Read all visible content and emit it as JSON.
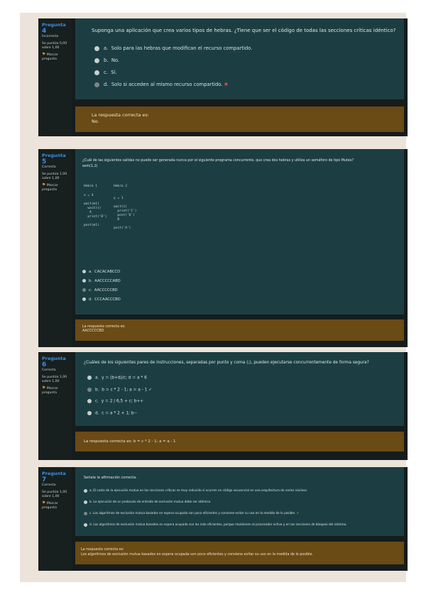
{
  "questions": [
    {
      "number_label": "Pregunta",
      "number": "4",
      "status": "Incorrecta",
      "score": "Se puntúa 0,00",
      "score_max": "sobre 1,00",
      "flag": "Marcar pregunta",
      "text": "Suponga una aplicación que crea varios tipos de hebras. ¿Tiene que ser el código de todas las secciones críticas idéntico?",
      "options": [
        {
          "letter": "a.",
          "text": "Solo para las hebras que modifican el recurso compartido."
        },
        {
          "letter": "b.",
          "text": "No."
        },
        {
          "letter": "c.",
          "text": "Sí."
        },
        {
          "letter": "d.",
          "text": "Solo si acceden al mismo recurso compartido."
        }
      ],
      "feedback_label": "La respuesta correcta es:",
      "feedback_answer": "No."
    },
    {
      "number_label": "Pregunta",
      "number": "5",
      "status": "Correcta",
      "score": "Se puntúa 1,00",
      "score_max": "sobre 1,00",
      "flag": "Marcar pregunta",
      "text": "¿Cuál de las siguientes salidas no puede ser generada nunca por el siguiente programa concurrente, que crea dos hebras y utiliza un semáforo de tipo Mutex?",
      "subtext": "sem(1,2)",
      "hebra1_title": "Hebra 1",
      "hebra2_title": "Hebra 2",
      "hebra1_code": "x = 4\n\nwait(m1)\n  wait(s)\n   A\n  print('B')\n\npost(m1)",
      "hebra2_code": "y = 1\n\nwait(s)\n  print('C')\n  post('D')\n  B\n\npost('A')",
      "options": [
        {
          "letter": "a.",
          "text": "CACACABCCD"
        },
        {
          "letter": "b.",
          "text": "AACCCCCABD"
        },
        {
          "letter": "c.",
          "text": "AACCCCCBD"
        },
        {
          "letter": "d.",
          "text": "CCCAACCCBD"
        }
      ],
      "feedback_label": "La respuesta correcta es:",
      "feedback_answer": "AACCCCCBD"
    },
    {
      "number_label": "Pregunta",
      "number": "6",
      "status": "Correcta",
      "score": "Se puntúa 1,00",
      "score_max": "sobre 1,00",
      "flag": "Marcar pregunta",
      "text": "¿Cuáles de los siguientes pares de instrucciones, separadas por punto y coma (;), pueden ejecutarse concurrentemente de forma segura?",
      "options": [
        {
          "letter": "a.",
          "text": "y = (b+d)/c; d = a * 6"
        },
        {
          "letter": "b.",
          "text": "b = c * 2 - 1; a = a - 1"
        },
        {
          "letter": "c.",
          "text": "y = 2 / 6,5 + c; b++"
        },
        {
          "letter": "d.",
          "text": "c = a * 2 + 1; b--"
        }
      ],
      "feedback_text": "La respuesta correcta es: b = c * 2 - 1; a = a - 1"
    },
    {
      "number_label": "Pregunta",
      "number": "7",
      "status": "Correcta",
      "score": "Se puntúa 1,00",
      "score_max": "sobre 1,00",
      "flag": "Marcar pregunta",
      "text": "Señale la afirmación correcta.",
      "options": [
        {
          "letter": "a.",
          "text": "El costo de la ejecución mutua en las secciones críticas es muy reducido si ocurren en código secuencial en una arquitectura de varios núcleos."
        },
        {
          "letter": "b.",
          "text": "La ejecución de un protocolo de entrada de exclusión mutua debe ser atómico."
        },
        {
          "letter": "c.",
          "text": "Los algoritmos de exclusión mutua basados en espera ocupada son poco eficientes y conviene evitar su uso en la medida de lo posible."
        },
        {
          "letter": "d.",
          "text": "Los algoritmos de exclusión mutua basados en espera ocupada son los más eficientes, porque mantienen al procesador activo y en las secciones de bloqueo del sistema."
        }
      ],
      "feedback_label": "La respuesta correcta es:",
      "feedback_answer": "Los algoritmos de exclusión mutua basados en espera ocupada son poco eficientes y conviene evitar su uso en la medida de lo posible."
    }
  ],
  "icons": {
    "flag": "flag-icon",
    "wrong": "cross-icon",
    "right": "check-icon"
  },
  "colors": {
    "accent": "#3d8fe0",
    "wrong": "#e8503a",
    "right": "#6fc94c",
    "feedback": "#6a4a15",
    "question": "#1c3e42"
  }
}
